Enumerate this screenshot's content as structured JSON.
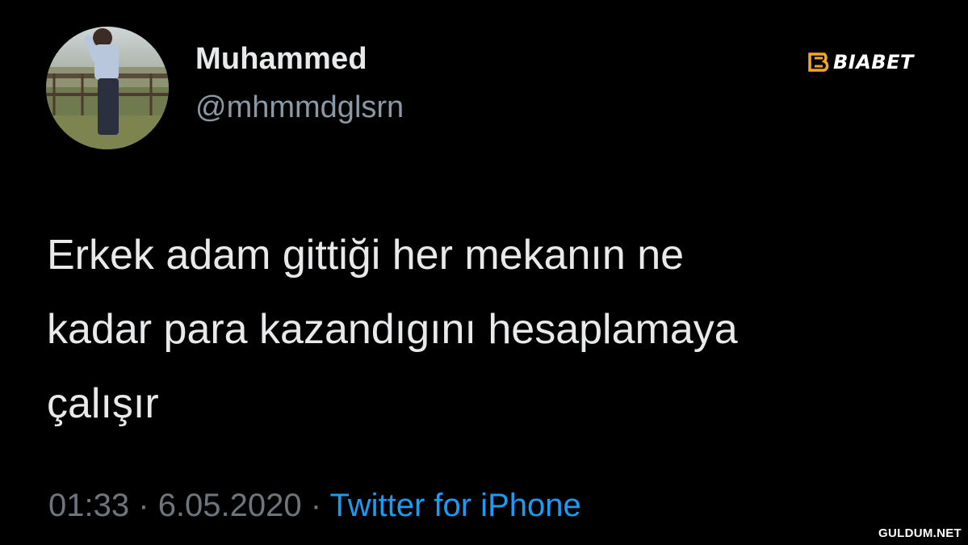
{
  "tweet": {
    "display_name": "Muhammed",
    "handle": "@mhmmdglsrn",
    "text_lines": [
      "Erkek adam gittiği her mekanın ne",
      "kadar para kazandıgını hesaplamaya",
      "çalışır"
    ],
    "time": "01:33",
    "separator": "·",
    "date": "6.05.2020",
    "source": "Twitter for iPhone"
  },
  "overlays": {
    "brand_logo_text": "BIABET",
    "watermark": "GULDUM.NET"
  },
  "colors": {
    "background": "#000000",
    "primary_text": "#e7e9ea",
    "secondary_text": "#8b98a5",
    "meta_text": "#6e767d",
    "link": "#1d9bf0",
    "brand_accent": "#f5a623"
  },
  "icons": {
    "avatar": "profile-photo",
    "brand": "biabet-logo-icon"
  }
}
